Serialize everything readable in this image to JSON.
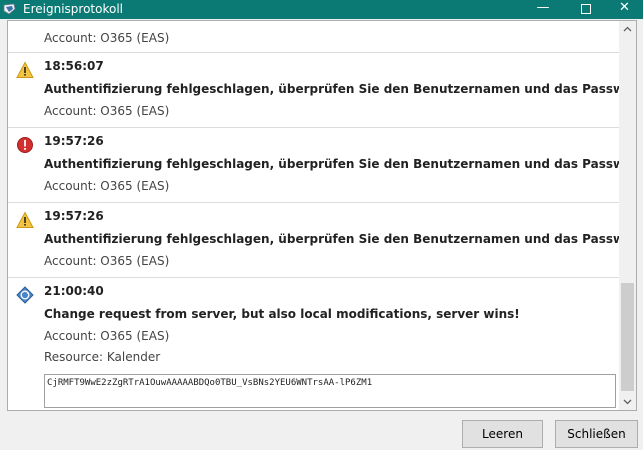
{
  "window": {
    "title": "Ereignisprotokoll",
    "accent_color": "#0b7a75",
    "minimize_glyph": "—",
    "close_glyph": "✕"
  },
  "log": {
    "entries": [
      {
        "type": "partial",
        "account": "Account: O365 (EAS)"
      },
      {
        "type": "warning",
        "icon": "warning-icon",
        "time": "18:56:07",
        "message": "Authentifizierung fehlgeschlagen, überprüfen Sie den Benutzernamen und das Passwort.",
        "account": "Account: O365 (EAS)"
      },
      {
        "type": "error",
        "icon": "error-icon",
        "time": "19:57:26",
        "message": "Authentifizierung fehlgeschlagen, überprüfen Sie den Benutzernamen und das Passwort.",
        "account": "Account: O365 (EAS)"
      },
      {
        "type": "warning",
        "icon": "warning-icon",
        "time": "19:57:26",
        "message": "Authentifizierung fehlgeschlagen, überprüfen Sie den Benutzernamen und das Passwort.",
        "account": "Account: O365 (EAS)"
      },
      {
        "type": "info",
        "icon": "sync-info-icon",
        "time": "21:00:40",
        "message": "Change request from server, but also local modifications, server wins!",
        "account": "Account: O365 (EAS)",
        "resource": "Resource: Kalender",
        "detail": "CjRMFT9WwE2zZgRTrA1OuwAAAAABDQo0TBU_VsBNs2YEU6WNTrsAA-lP6ZM1"
      }
    ]
  },
  "buttons": {
    "clear_label": "Leeren",
    "close_label": "Schließen"
  }
}
